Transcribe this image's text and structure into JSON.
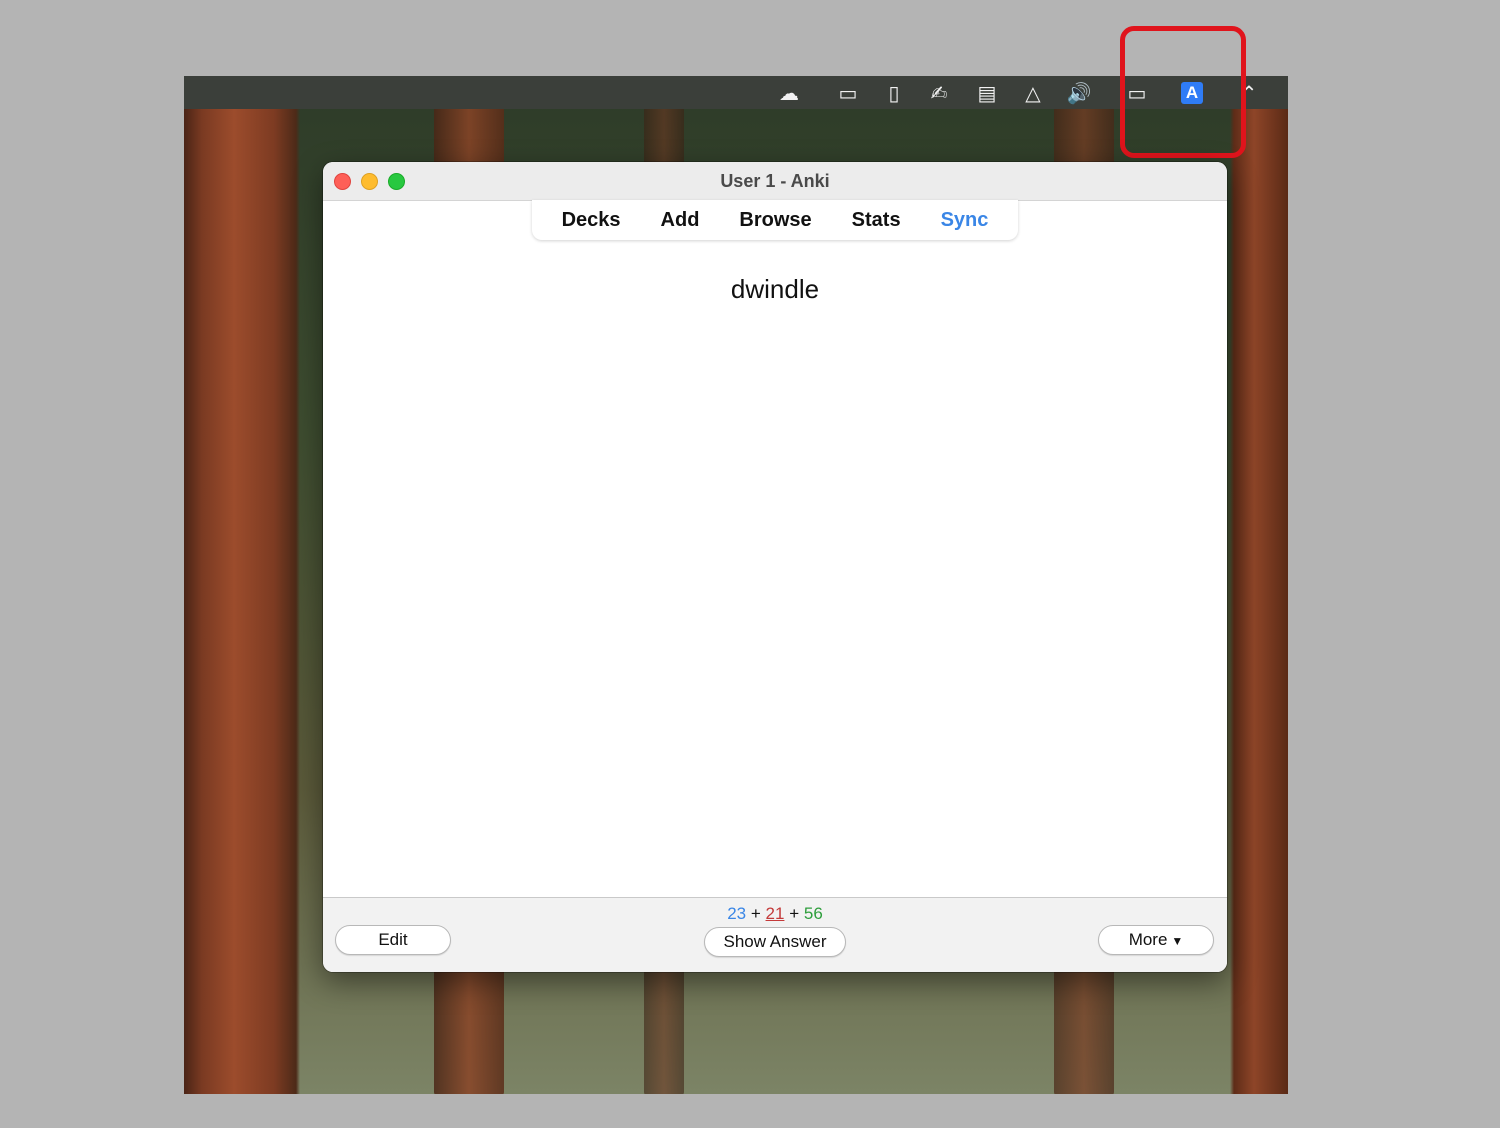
{
  "menubar": {
    "icons": [
      {
        "name": "hat-icon",
        "glyph": "☁"
      },
      {
        "name": "window-dots-icon",
        "glyph": "▭"
      },
      {
        "name": "document-icon",
        "glyph": "▯"
      },
      {
        "name": "signature-icon",
        "glyph": "✍"
      },
      {
        "name": "clipboard-icon",
        "glyph": "▤"
      },
      {
        "name": "drive-icon",
        "glyph": "△"
      },
      {
        "name": "volume-icon",
        "glyph": "🔊"
      },
      {
        "name": "battery-icon",
        "glyph": "▭"
      },
      {
        "name": "input-source-icon",
        "glyph": "A"
      },
      {
        "name": "wifi-icon",
        "glyph": "⌃"
      }
    ]
  },
  "window": {
    "title": "User 1 - Anki"
  },
  "toolbar": {
    "decks": "Decks",
    "add": "Add",
    "browse": "Browse",
    "stats": "Stats",
    "sync": "Sync"
  },
  "card": {
    "front": "dwindle"
  },
  "bottombar": {
    "edit_label": "Edit",
    "show_answer_label": "Show Answer",
    "more_label": "More",
    "counts": {
      "new": "23",
      "learn": "21",
      "review": "56",
      "sep": "+"
    }
  },
  "colors": {
    "sync_link": "#3a86e6",
    "count_new": "#3a86e6",
    "count_learn": "#c43a3a",
    "count_review": "#2e9e3c",
    "highlight_box": "#e0141c"
  }
}
